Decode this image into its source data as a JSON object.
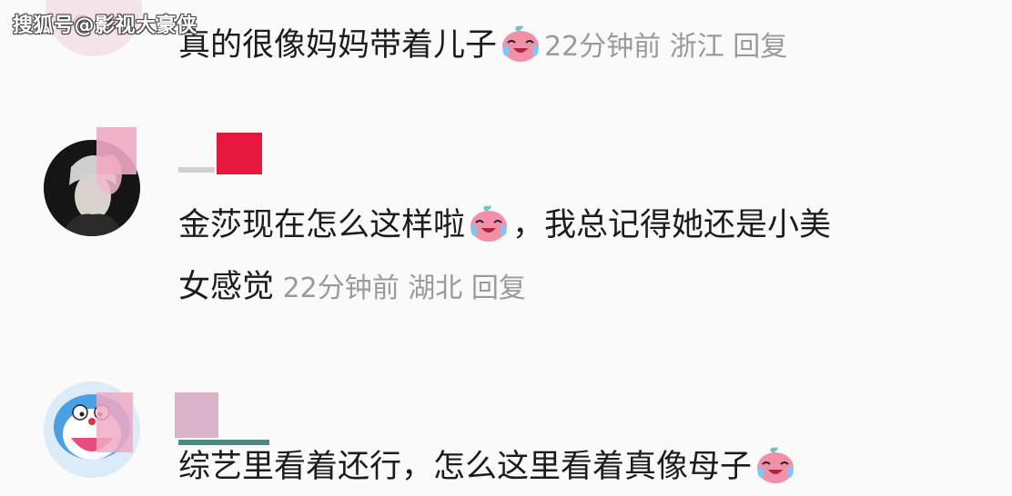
{
  "watermark": "搜狐号@影视大豪侠",
  "comments": [
    {
      "text": "真的很像妈妈带着儿子",
      "emoji": "crying-laughing-emoji",
      "time": "22分钟前",
      "location": "浙江",
      "reply": "回复"
    },
    {
      "text_line1": "金莎现在怎么这样啦",
      "emoji": "crying-laughing-emoji",
      "text_line1b": "，我总记得她还是小美",
      "text_line2": "女感觉",
      "time": "22分钟前",
      "location": "湖北",
      "reply": "回复"
    },
    {
      "text": "综艺里看着还行，怎么这里看着真像母子",
      "emoji": "crying-laughing-emoji"
    }
  ],
  "colors": {
    "background": "#fafafa",
    "text": "#1c1c1c",
    "meta": "#9a9a9a",
    "censor_red": "#e5173f",
    "censor_pink": "#f0a9c4"
  }
}
